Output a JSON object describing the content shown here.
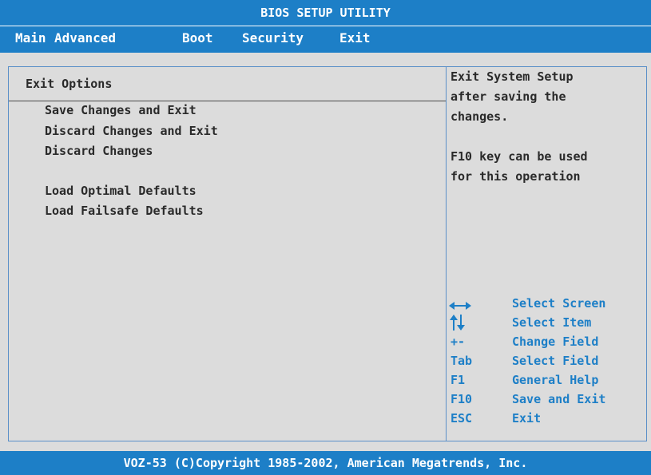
{
  "window": {
    "title": "BIOS SETUP UTILITY"
  },
  "menu": {
    "items": [
      {
        "label": "Main"
      },
      {
        "label": "Advanced"
      },
      {
        "label": "Boot"
      },
      {
        "label": "Security"
      },
      {
        "label": "Exit"
      }
    ],
    "selected": "Exit"
  },
  "main": {
    "section_title": "Exit Options",
    "options": [
      {
        "label": "Save Changes and Exit"
      },
      {
        "label": "Discard Changes and Exit"
      },
      {
        "label": "Discard Changes"
      },
      {
        "label": "Load Optimal Defaults"
      },
      {
        "label": "Load Failsafe Defaults"
      }
    ]
  },
  "help": {
    "lines": [
      "Exit System Setup",
      "after saving the",
      "changes.",
      "F10 key can be used",
      "for this operation"
    ]
  },
  "keys": [
    {
      "key_icon": "left-right-arrow-icon",
      "key": "",
      "desc": "Select Screen"
    },
    {
      "key_icon": "up-down-arrow-icon",
      "key": "",
      "desc": "Select Item"
    },
    {
      "key": "+-",
      "desc": "Change Field"
    },
    {
      "key": "Tab",
      "desc": "Select Field"
    },
    {
      "key": "F1",
      "desc": "General Help"
    },
    {
      "key": "F10",
      "desc": "Save and Exit"
    },
    {
      "key": "ESC",
      "desc": "Exit"
    }
  ],
  "footer": {
    "copyright": "VOZ-53 (C)Copyright 1985-2002, American Megatrends, Inc."
  },
  "colors": {
    "accent": "#1d7fc7",
    "background": "#dcdcdc",
    "text": "#2a2a2a"
  }
}
